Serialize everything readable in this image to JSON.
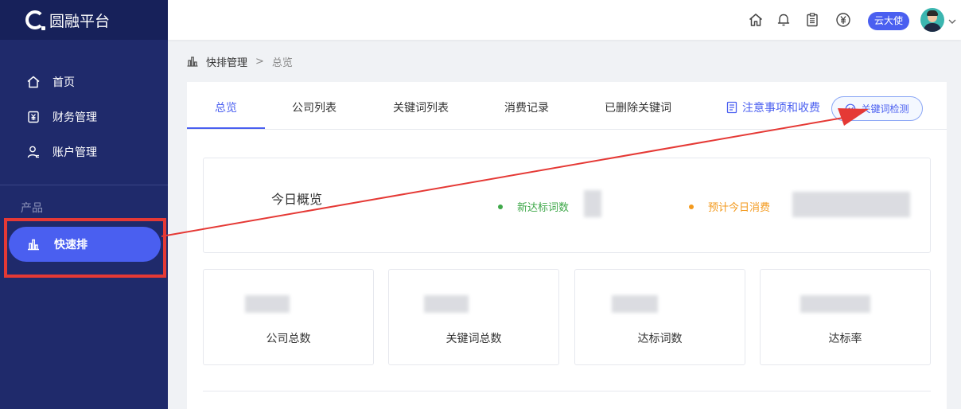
{
  "brand": {
    "name": "圆融平台"
  },
  "sidebar": {
    "items": [
      {
        "label": "首页",
        "icon": "home-icon"
      },
      {
        "label": "财务管理",
        "icon": "finance-icon"
      },
      {
        "label": "账户管理",
        "icon": "user-icon"
      }
    ],
    "section_title": "产品",
    "active_item": {
      "label": "快速排",
      "icon": "bar-chart-icon"
    }
  },
  "header": {
    "icons": [
      "home-icon",
      "bell-icon",
      "clipboard-icon",
      "yen-icon"
    ],
    "user_badge": "云大使"
  },
  "breadcrumb": {
    "parent": "快排管理",
    "separator": ">",
    "current": "总览"
  },
  "tabs": [
    {
      "label": "总览",
      "active": true
    },
    {
      "label": "公司列表",
      "active": false
    },
    {
      "label": "关键词列表",
      "active": false
    },
    {
      "label": "消费记录",
      "active": false
    },
    {
      "label": "已删除关键词",
      "active": false
    }
  ],
  "notice_link": "注意事项和收费",
  "detect_button": "关键词检测",
  "overview": {
    "title": "今日概览",
    "stats": [
      {
        "label": "新达标词数",
        "color": "#3fa84a"
      },
      {
        "label": "预计今日消费",
        "color": "#f39a1e"
      }
    ]
  },
  "stat_boxes": [
    {
      "label": "公司总数"
    },
    {
      "label": "关键词总数"
    },
    {
      "label": "达标词数"
    },
    {
      "label": "达标率"
    }
  ],
  "colors": {
    "accent": "#4a5ff0",
    "sidebar": "#1f2a6b",
    "annotation": "#e53935"
  }
}
